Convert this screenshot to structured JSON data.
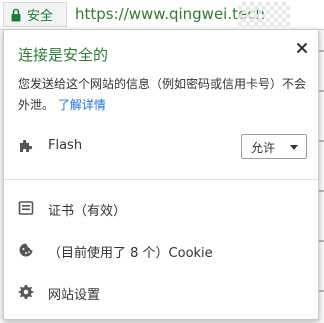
{
  "address_bar": {
    "secure_label": "安全",
    "url": "https://www.qingwei.tech"
  },
  "popup": {
    "title": "连接是安全的",
    "description": "您发送给这个网站的信息（例如密码或信用卡号）不会外泄。",
    "learn_more": "了解详情",
    "close_icon": "close-icon",
    "flash": {
      "label": "Flash",
      "icon": "puzzle-icon",
      "selected_option": "允许"
    },
    "items": [
      {
        "label": "证书（有效）",
        "icon": "certificate-icon"
      },
      {
        "label": "（目前使用了 8 个）Cookie",
        "icon": "cookie-icon"
      },
      {
        "label": "网站设置",
        "icon": "gear-icon"
      }
    ]
  },
  "colors": {
    "secure_green": "#188038",
    "title_green": "#2e7d32",
    "link_blue": "#1a73e8",
    "text": "#333333"
  }
}
